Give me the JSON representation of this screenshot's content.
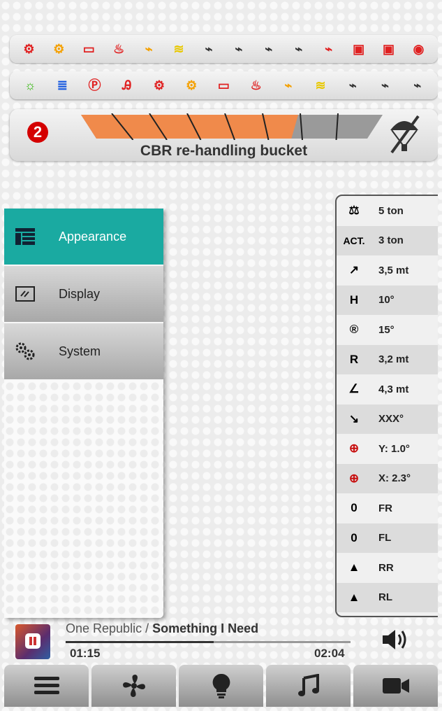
{
  "warning_row_1": {
    "icons": [
      {
        "name": "engine-stop-icon",
        "glyph": "⚙",
        "color": "#e02020"
      },
      {
        "name": "engine-check-icon",
        "glyph": "⚙",
        "color": "#f4a000"
      },
      {
        "name": "battery-icon",
        "glyph": "▭",
        "color": "#e02020"
      },
      {
        "name": "oil-pressure-icon",
        "glyph": "♨",
        "color": "#e02020"
      },
      {
        "name": "glow-plug-icon",
        "glyph": "⌁",
        "color": "#f4a000"
      },
      {
        "name": "coolant-temp-icon",
        "glyph": "≋",
        "color": "#e8c800"
      },
      {
        "name": "transmission-icon",
        "glyph": "⌁",
        "color": "#333333"
      },
      {
        "name": "transmission-off-icon",
        "glyph": "⌁",
        "color": "#333333"
      },
      {
        "name": "transmission-temp-icon",
        "glyph": "⌁",
        "color": "#333333"
      },
      {
        "name": "transmission-ack-icon",
        "glyph": "⌁",
        "color": "#333333"
      },
      {
        "name": "transmission-warning-icon",
        "glyph": "⌁",
        "color": "#e02020"
      },
      {
        "name": "hydraulic-filter-icon",
        "glyph": "▣",
        "color": "#e02020"
      },
      {
        "name": "hydraulic-temp-icon",
        "glyph": "▣",
        "color": "#e02020"
      },
      {
        "name": "hydraulic-oil-icon",
        "glyph": "◉",
        "color": "#e02020"
      }
    ]
  },
  "warning_row_2": {
    "icons": [
      {
        "name": "sidelights-icon",
        "glyph": "☼",
        "color": "#2ab500"
      },
      {
        "name": "high-beam-icon",
        "glyph": "≣",
        "color": "#1a5be0"
      },
      {
        "name": "parking-brake-icon",
        "glyph": "Ⓟ",
        "color": "#e02020"
      },
      {
        "name": "seatbelt-icon",
        "glyph": "Ꭿ",
        "color": "#e02020"
      },
      {
        "name": "engine-stop-icon-2",
        "glyph": "⚙",
        "color": "#e02020"
      },
      {
        "name": "engine-check-icon-2",
        "glyph": "⚙",
        "color": "#f4a000"
      },
      {
        "name": "battery-icon-2",
        "glyph": "▭",
        "color": "#e02020"
      },
      {
        "name": "oil-pressure-icon-2",
        "glyph": "♨",
        "color": "#e02020"
      },
      {
        "name": "glow-plug-icon-2",
        "glyph": "⌁",
        "color": "#f4a000"
      },
      {
        "name": "coolant-temp-icon-2",
        "glyph": "≋",
        "color": "#e8c800"
      },
      {
        "name": "transmission-icon-2",
        "glyph": "⌁",
        "color": "#333333"
      },
      {
        "name": "transmission-off-icon-2",
        "glyph": "⌁",
        "color": "#333333"
      },
      {
        "name": "transmission-temp-icon-2",
        "glyph": "⌁",
        "color": "#333333"
      }
    ]
  },
  "bucket": {
    "badge": "2",
    "title": "CBR re-handling bucket",
    "fill_level": 0.72,
    "segments": 8
  },
  "menu": {
    "items": [
      {
        "label": "Appearance",
        "icon": "list-icon",
        "active": true
      },
      {
        "label": "Display",
        "icon": "display-icon",
        "active": false
      },
      {
        "label": "System",
        "icon": "gears-icon",
        "active": false
      }
    ]
  },
  "stats": [
    {
      "icon": "weight-icon",
      "icon_text": "",
      "value": "5 ton"
    },
    {
      "icon": "actual-load-icon",
      "icon_text": "ACT.",
      "value": "3 ton"
    },
    {
      "icon": "boom-length-icon",
      "icon_text": "",
      "value": "3,5 mt"
    },
    {
      "icon": "height-icon",
      "icon_text": "",
      "value": "10°"
    },
    {
      "icon": "rotation-icon",
      "icon_text": "",
      "value": "15°"
    },
    {
      "icon": "radius-icon",
      "icon_text": "",
      "value": "3,2 mt"
    },
    {
      "icon": "angle-icon",
      "icon_text": "",
      "value": "4,3 mt"
    },
    {
      "icon": "bucket-angle-icon",
      "icon_text": "",
      "value": "XXX°"
    },
    {
      "icon": "crosshair-y-icon",
      "icon_text": "",
      "value": "Y: 1.0°"
    },
    {
      "icon": "crosshair-x-icon",
      "icon_text": "",
      "value": "X: 2.3°"
    },
    {
      "icon": "tire-fr-icon",
      "icon_text": "",
      "value": "FR"
    },
    {
      "icon": "tire-fl-icon",
      "icon_text": "",
      "value": "FL"
    },
    {
      "icon": "track-rr-icon",
      "icon_text": "",
      "value": "RR"
    },
    {
      "icon": "track-rl-icon",
      "icon_text": "",
      "value": "RL"
    }
  ],
  "player": {
    "artist": "One Republic",
    "separator": " / ",
    "song": "Something I Need",
    "elapsed": "01:15",
    "total": "02:04",
    "progress": 0.52
  },
  "bottom_bar": {
    "tabs": [
      {
        "icon": "menu-icon"
      },
      {
        "icon": "fan-icon"
      },
      {
        "icon": "bulb-icon"
      },
      {
        "icon": "music-icon"
      },
      {
        "icon": "camera-icon"
      }
    ]
  },
  "colors": {
    "accent": "#1aaaa1",
    "bucket_fill": "#f08a4b",
    "alert_red": "#d40000"
  }
}
